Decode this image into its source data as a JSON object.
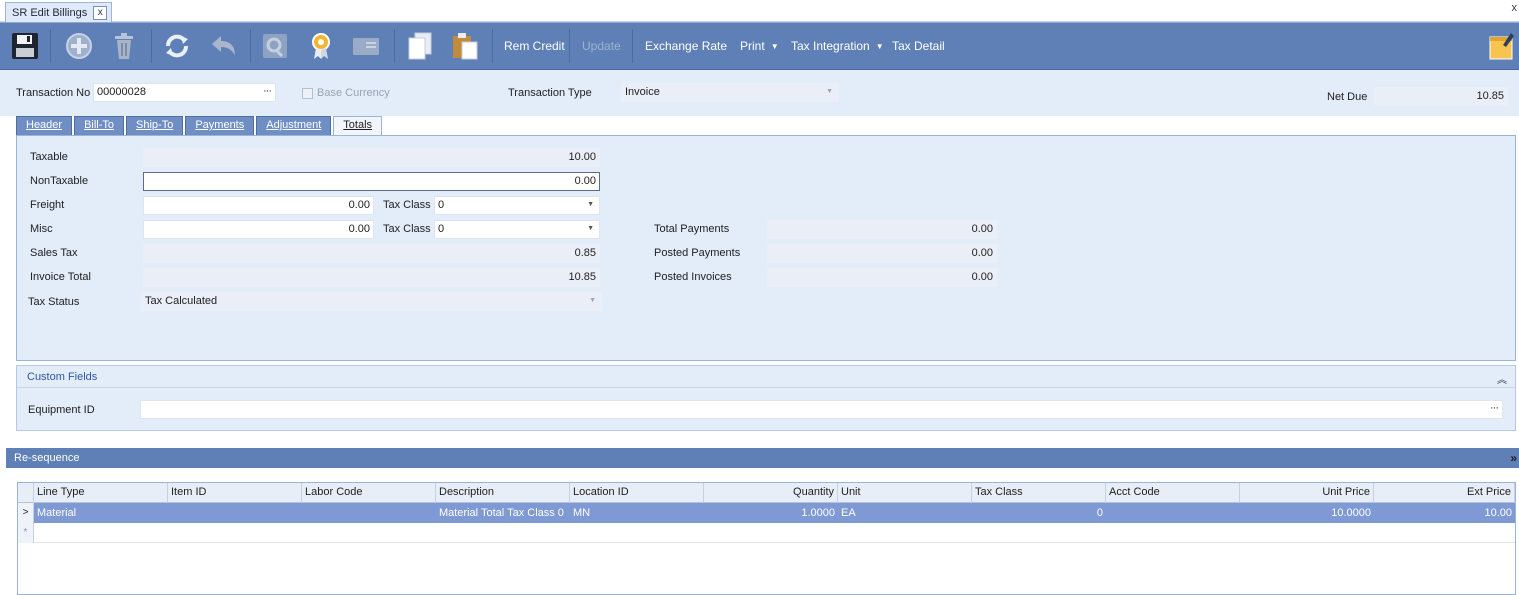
{
  "window": {
    "tab_title": "SR Edit Billings",
    "tab_close": "x",
    "strip_close": "x"
  },
  "toolbar": {
    "icons": [
      "save-icon",
      "add-icon",
      "delete-icon",
      "refresh-icon",
      "undo-icon",
      "search-icon",
      "certificate-icon",
      "card-icon",
      "copy-icon",
      "paste-icon"
    ],
    "rem_credit": "Rem Credit",
    "update": "Update",
    "exchange_rate": "Exchange Rate",
    "print": "Print",
    "tax_integration": "Tax Integration",
    "tax_detail": "Tax Detail",
    "notes_icon": "notes-icon",
    "colors": {
      "bar": "#5f80b6",
      "text": "#ffffff",
      "disabled_text": "#9fb2d3"
    }
  },
  "header": {
    "transaction_no_label": "Transaction No",
    "transaction_no": "00000028",
    "lookup": "···",
    "base_currency_label": "Base Currency",
    "base_currency_checked": false,
    "transaction_type_label": "Transaction Type",
    "transaction_type": "Invoice",
    "net_due_label": "Net Due",
    "net_due": "10.85"
  },
  "tabs": [
    {
      "label": "Header",
      "active": false
    },
    {
      "label": "Bill-To",
      "active": false
    },
    {
      "label": "Ship-To",
      "active": false
    },
    {
      "label": "Payments",
      "active": false
    },
    {
      "label": "Adjustment",
      "active": false
    },
    {
      "label": "Totals",
      "active": true
    }
  ],
  "totals": {
    "taxable_label": "Taxable",
    "taxable": "10.00",
    "nontaxable_label": "NonTaxable",
    "nontaxable": "0.00",
    "freight_label": "Freight",
    "freight": "0.00",
    "freight_tax_class_label": "Tax Class",
    "freight_tax_class": "0",
    "misc_label": "Misc",
    "misc": "0.00",
    "misc_tax_class_label": "Tax Class",
    "misc_tax_class": "0",
    "sales_tax_label": "Sales Tax",
    "sales_tax": "0.85",
    "invoice_total_label": "Invoice Total",
    "invoice_total": "10.85",
    "tax_status_label": "Tax Status",
    "tax_status": "Tax Calculated",
    "total_payments_label": "Total Payments",
    "total_payments": "0.00",
    "posted_payments_label": "Posted Payments",
    "posted_payments": "0.00",
    "posted_invoices_label": "Posted Invoices",
    "posted_invoices": "0.00"
  },
  "custom_fields": {
    "title": "Custom Fields",
    "equipment_id_label": "Equipment ID",
    "equipment_id": "",
    "lookup": "···"
  },
  "resequence": {
    "label": "Re-sequence",
    "expand": "»"
  },
  "grid": {
    "columns": [
      "Line Type",
      "Item ID",
      "Labor Code",
      "Description",
      "Location ID",
      "Quantity",
      "Unit",
      "Tax Class",
      "Acct Code",
      "Unit Price",
      "Ext Price"
    ],
    "rows": [
      {
        "indicator": ">",
        "line_type": "Material",
        "item_id": "",
        "labor_code": "",
        "description": "Material Total Tax Class 0",
        "location_id": "MN",
        "quantity": "1.0000",
        "unit": "EA",
        "tax_class": "0",
        "acct_code": "",
        "unit_price": "10.0000",
        "ext_price": "10.00"
      }
    ],
    "new_row_indicator": "*"
  }
}
